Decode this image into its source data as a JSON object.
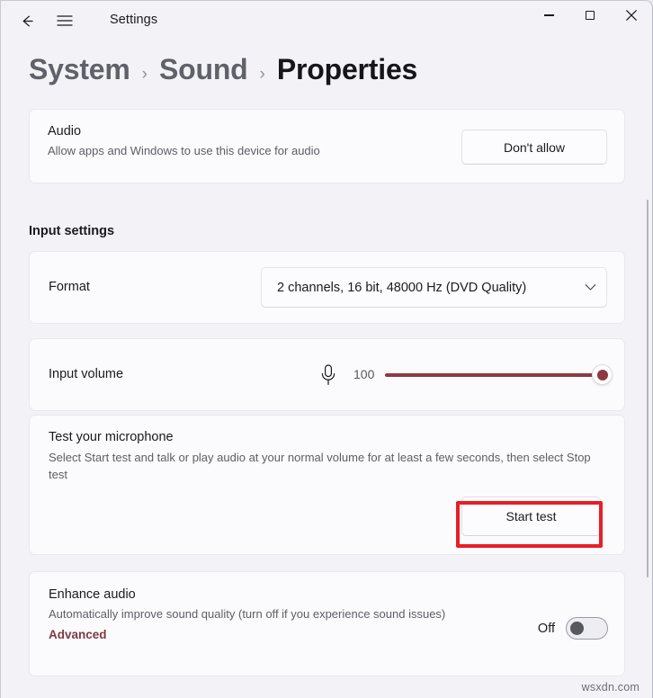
{
  "window": {
    "title": "Settings",
    "controls": {
      "back": "back-arrow",
      "menu": "hamburger",
      "minimize": "minimize",
      "maximize": "maximize",
      "close": "close"
    }
  },
  "breadcrumb": {
    "items": [
      "System",
      "Sound",
      "Properties"
    ],
    "separator": "›"
  },
  "audio_card": {
    "title": "Audio",
    "subtitle": "Allow apps and Windows to use this device for audio",
    "button_label": "Don't allow"
  },
  "input_settings": {
    "section_title": "Input settings",
    "format": {
      "label": "Format",
      "value": "2 channels, 16 bit, 48000 Hz (DVD Quality)"
    },
    "input_volume": {
      "label": "Input volume",
      "value": "100",
      "icon": "microphone-icon",
      "percent": 100
    },
    "mic_test": {
      "title": "Test your microphone",
      "subtitle": "Select Start test and talk or play audio at your normal volume for at least a few seconds, then select Stop test",
      "button_label": "Start test"
    },
    "enhance_audio": {
      "title": "Enhance audio",
      "subtitle": "Automatically improve sound quality (turn off if you experience sound issues)",
      "link_label": "Advanced",
      "toggle_state": "Off"
    }
  },
  "annotation": {
    "highlight_color": "#e81e26",
    "target": "Start test"
  },
  "watermark": "wsxdn.com",
  "colors": {
    "accent": "#8d3a42",
    "page_background": "#f3f3f7",
    "card_background": "#fbfbfd",
    "text_primary": "#1b1b1f",
    "text_secondary": "#5d5d67",
    "link": "#7c3b43"
  }
}
